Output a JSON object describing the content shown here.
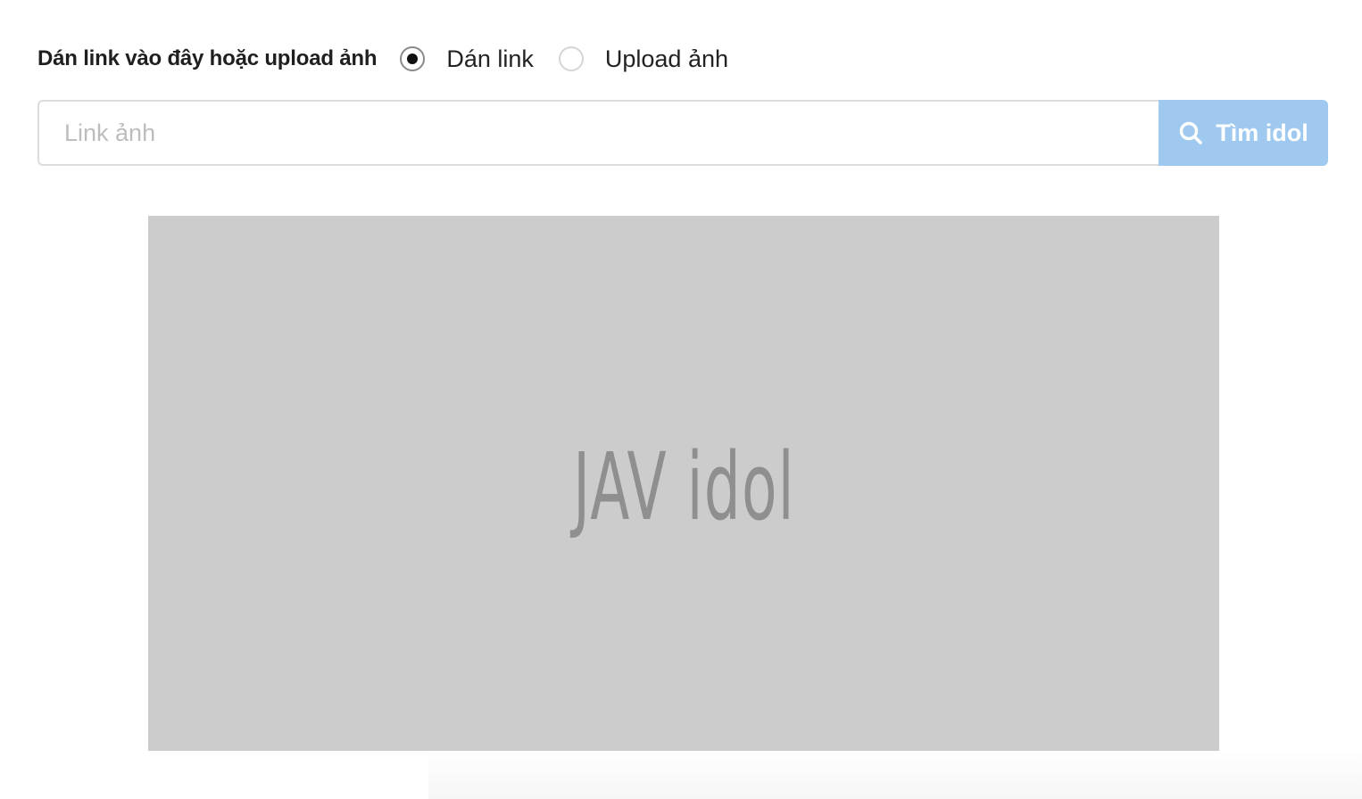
{
  "mode": {
    "label": "Dán link vào đây hoặc upload ảnh",
    "options": [
      {
        "label": "Dán link",
        "checked": true
      },
      {
        "label": "Upload ảnh",
        "checked": false
      }
    ]
  },
  "search": {
    "placeholder": "Link ảnh",
    "value": "",
    "button_label": "Tìm idol",
    "button_color": "#9fc9ee",
    "icon": "search-icon"
  },
  "preview": {
    "text": "JAV idol",
    "background": "#cccccc",
    "text_color": "#8f8f8f"
  }
}
